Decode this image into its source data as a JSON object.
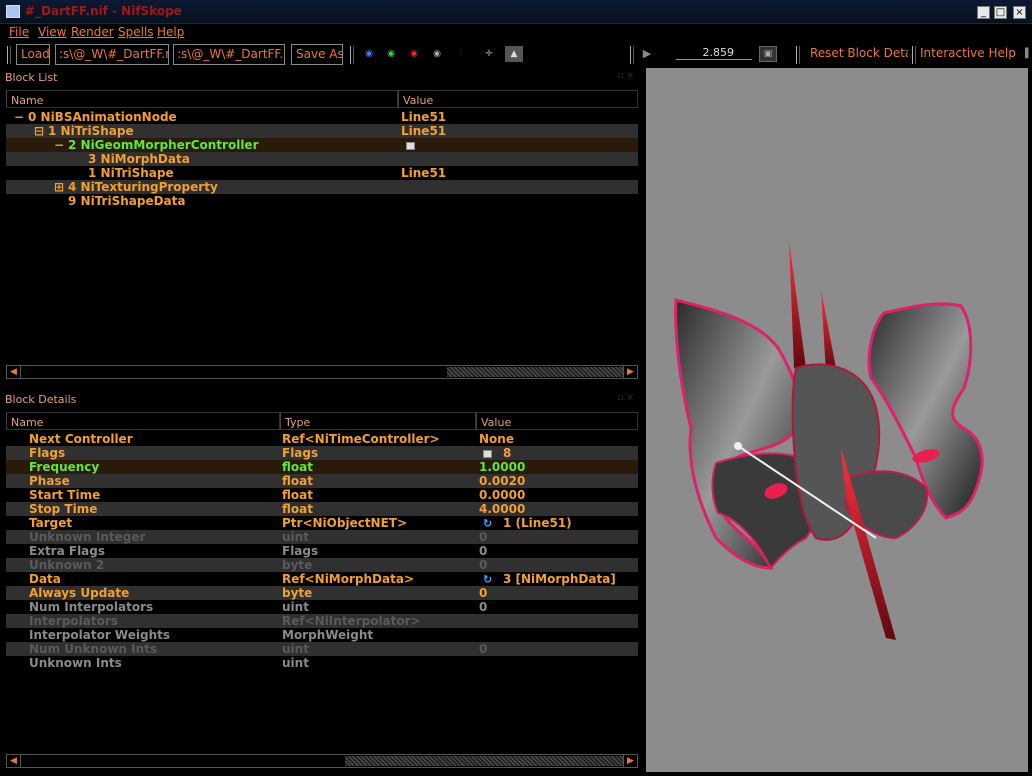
{
  "window": {
    "title": "#_DartFF.nif - NifSkope",
    "min": "_",
    "max": "□",
    "close": "×"
  },
  "menu": {
    "file": "File",
    "view": "View",
    "render": "Render",
    "spells": "Spells",
    "help": "Help"
  },
  "toolbar": {
    "load": "Load",
    "load_path": ":s\\@_W\\#_DartFF.nif",
    "save_path": ":s\\@_W\\#_DartFF.nif",
    "save_as": "Save As",
    "time_value": "2.859",
    "reset_block_details": "Reset Block Details",
    "interactive_help": "Interactive Help"
  },
  "block_list": {
    "title": "Block List",
    "headers": {
      "name": "Name",
      "value": "Value"
    },
    "rows": [
      {
        "expander": "−",
        "name": "0  NiBSAnimationNode",
        "value": "Line51",
        "color": "orange"
      },
      {
        "expander": "⊟",
        "name": "1  NiTriShape",
        "value": "Line51",
        "color": "orange"
      },
      {
        "expander": "−",
        "name": "2  NiGeomMorpherController",
        "value": "",
        "color": "green"
      },
      {
        "expander": "",
        "name": "3  NiMorphData",
        "value": "",
        "color": "orange"
      },
      {
        "expander": "",
        "name": "1  NiTriShape",
        "value": "Line51",
        "color": "orange"
      },
      {
        "expander": "⊞",
        "name": "4  NiTexturingProperty",
        "value": "",
        "color": "orange"
      },
      {
        "expander": "",
        "name": "9  NiTriShapeData",
        "value": "",
        "color": "orange"
      }
    ]
  },
  "block_details": {
    "title": "Block Details",
    "headers": {
      "name": "Name",
      "type": "Type",
      "value": "Value"
    },
    "rows": [
      {
        "name": "Next Controller",
        "type": "Ref<NiTimeController>",
        "value": "None",
        "color": "orange",
        "icon": ""
      },
      {
        "name": "Flags",
        "type": "Flags",
        "value": "8",
        "color": "orange",
        "icon": "flag"
      },
      {
        "name": "Frequency",
        "type": "float",
        "value": "1.0000",
        "color": "green",
        "icon": ""
      },
      {
        "name": "Phase",
        "type": "float",
        "value": "0.0020",
        "color": "orange",
        "icon": ""
      },
      {
        "name": "Start Time",
        "type": "float",
        "value": "0.0000",
        "color": "orange",
        "icon": ""
      },
      {
        "name": "Stop Time",
        "type": "float",
        "value": "4.0000",
        "color": "orange",
        "icon": ""
      },
      {
        "name": "Target",
        "type": "Ptr<NiObjectNET>",
        "value": "1 (Line51)",
        "color": "orange",
        "icon": "link"
      },
      {
        "name": "Unknown Integer",
        "type": "uint",
        "value": "0",
        "color": "dark",
        "icon": ""
      },
      {
        "name": "Extra Flags",
        "type": "Flags",
        "value": "0",
        "color": "gray",
        "icon": ""
      },
      {
        "name": "Unknown 2",
        "type": "byte",
        "value": "0",
        "color": "dark",
        "icon": ""
      },
      {
        "name": "Data",
        "type": "Ref<NiMorphData>",
        "value": "3 [NiMorphData]",
        "color": "orange",
        "icon": "link"
      },
      {
        "name": "Always Update",
        "type": "byte",
        "value": "0",
        "color": "orange",
        "icon": ""
      },
      {
        "name": "Num Interpolators",
        "type": "uint",
        "value": "0",
        "color": "gray",
        "icon": ""
      },
      {
        "name": "Interpolators",
        "type": "Ref<NiInterpolator>",
        "value": "",
        "color": "dark",
        "icon": ""
      },
      {
        "name": "Interpolator Weights",
        "type": "MorphWeight",
        "value": "",
        "color": "gray",
        "icon": ""
      },
      {
        "name": "Num Unknown Ints",
        "type": "uint",
        "value": "0",
        "color": "dark",
        "icon": ""
      },
      {
        "name": "Unknown Ints",
        "type": "uint",
        "value": "",
        "color": "gray",
        "icon": ""
      }
    ]
  },
  "colors": {
    "accent": "#f07830",
    "orange_text": "#f0a030",
    "green_text": "#60e838",
    "viewport_bg": "#8c8c8c",
    "model_red": "#d01830"
  }
}
